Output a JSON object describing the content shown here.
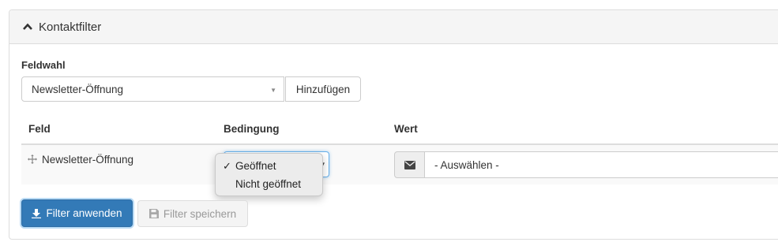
{
  "panel": {
    "title": "Kontaktfilter",
    "toggle_icon": "chevron-up-icon"
  },
  "field_choice": {
    "label": "Feldwahl",
    "selected": "Newsletter-Öffnung",
    "add_label": "Hinzufügen"
  },
  "table": {
    "headers": {
      "field": "Feld",
      "condition": "Bedingung",
      "value": "Wert"
    },
    "row": {
      "field": "Newsletter-Öffnung",
      "handle_icon": "move-icon",
      "condition_options": [
        "Geöffnet",
        "Nicht geöffnet"
      ],
      "condition_selected": "Geöffnet",
      "check_mark": "✓",
      "value_icon": "envelope-icon",
      "value_placeholder": "- Auswählen -"
    }
  },
  "actions": {
    "apply_label": "Filter anwenden",
    "apply_icon": "download-icon",
    "save_label": "Filter speichern",
    "save_icon": "floppy-disk-icon"
  },
  "colors": {
    "primary": "#337ab7",
    "focus": "#66afe9",
    "panel_heading": "#f5f5f5"
  }
}
